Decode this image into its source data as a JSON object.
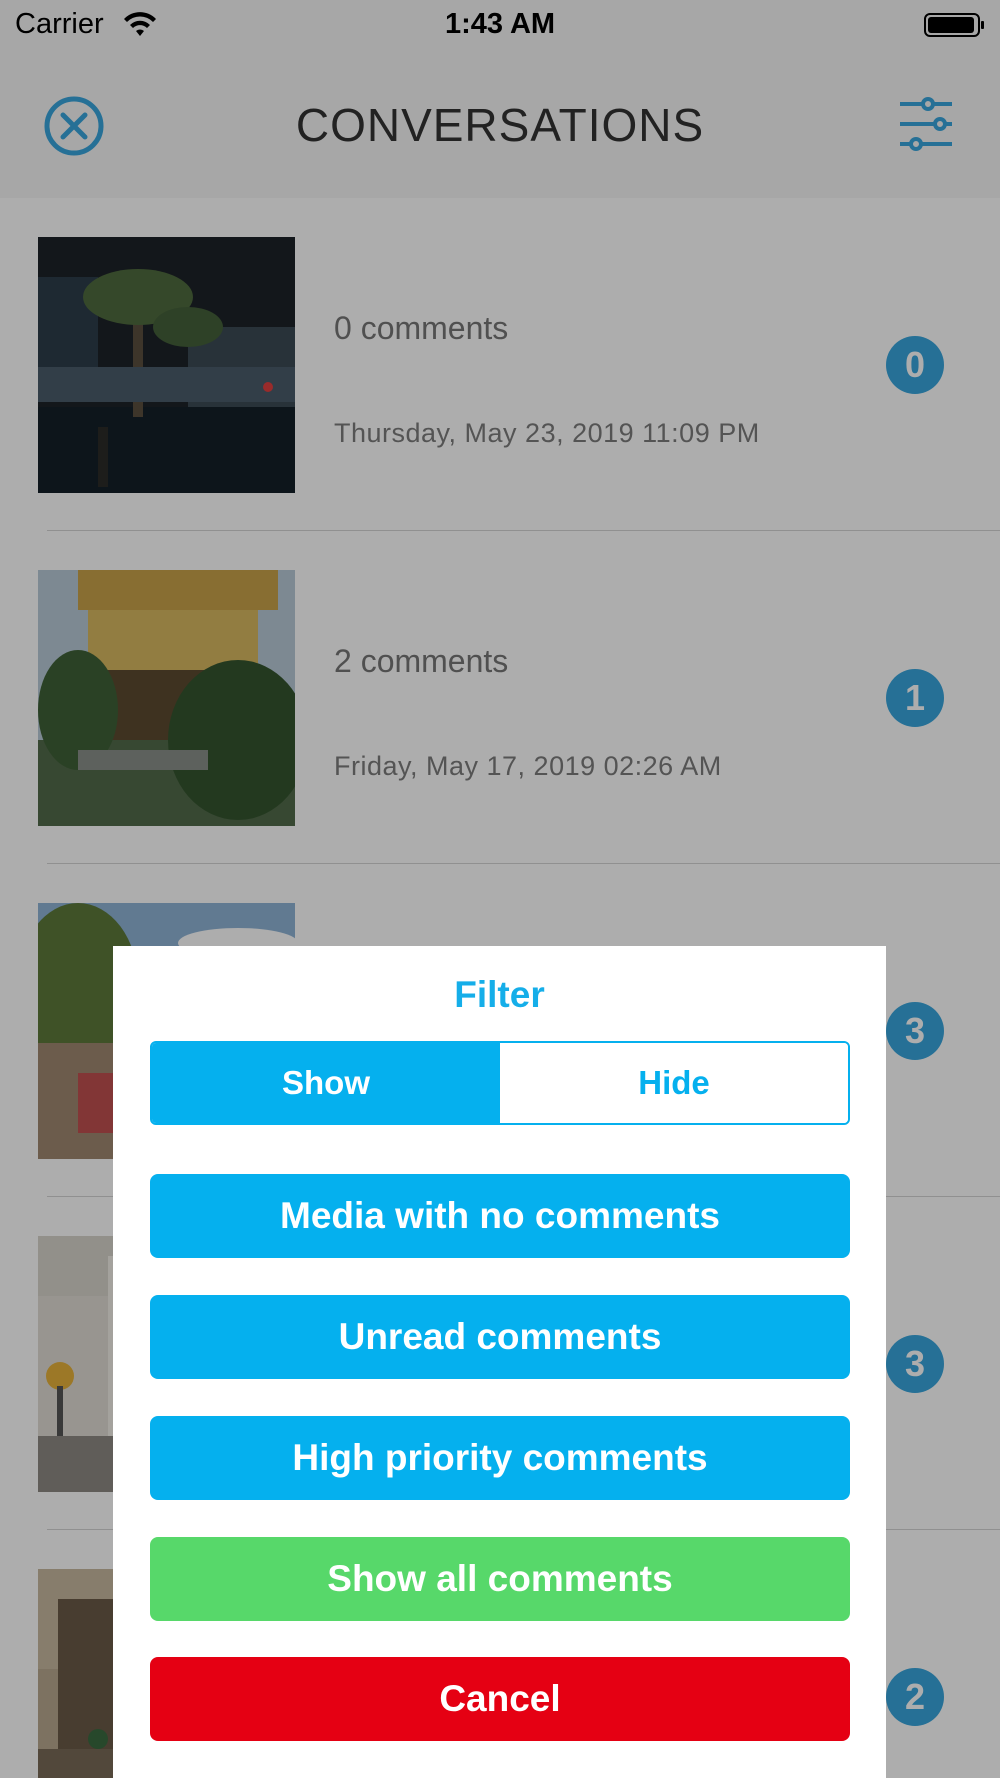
{
  "status_bar": {
    "carrier": "Carrier",
    "time": "1:43 AM",
    "icons": [
      "wifi-icon",
      "battery-icon"
    ]
  },
  "nav": {
    "title": "CONVERSATIONS",
    "close_icon": "close-circle-icon",
    "filter_icon": "sliders-icon",
    "accent_color": "#39a6dd"
  },
  "conversations": [
    {
      "comments": "0 comments",
      "date": "Thursday, May 23, 2019 11:09 PM",
      "badge": "0",
      "thumbnail": "night palm trees reflected in water"
    },
    {
      "comments": "2 comments",
      "date": "Friday, May 17, 2019 02:26 AM",
      "badge": "1",
      "thumbnail": "golden pavilion temple with pine tree"
    },
    {
      "comments": "",
      "date": "",
      "badge": "3",
      "thumbnail": "street scene with trees and blue sky"
    },
    {
      "comments": "",
      "date": "",
      "badge": "3",
      "thumbnail": "white building facade with street sign"
    },
    {
      "comments": "",
      "date": "",
      "badge": "2",
      "thumbnail": "ornate building street"
    }
  ],
  "filter_sheet": {
    "title": "Filter",
    "segment": {
      "show": "Show",
      "hide": "Hide",
      "selected": "Show"
    },
    "options": {
      "no_comments": "Media with no comments",
      "unread": "Unread comments",
      "high_priority": "High priority comments",
      "show_all": "Show all comments",
      "cancel": "Cancel"
    },
    "colors": {
      "blue": "#05b0ee",
      "green": "#57d86a",
      "red": "#e50013"
    }
  }
}
